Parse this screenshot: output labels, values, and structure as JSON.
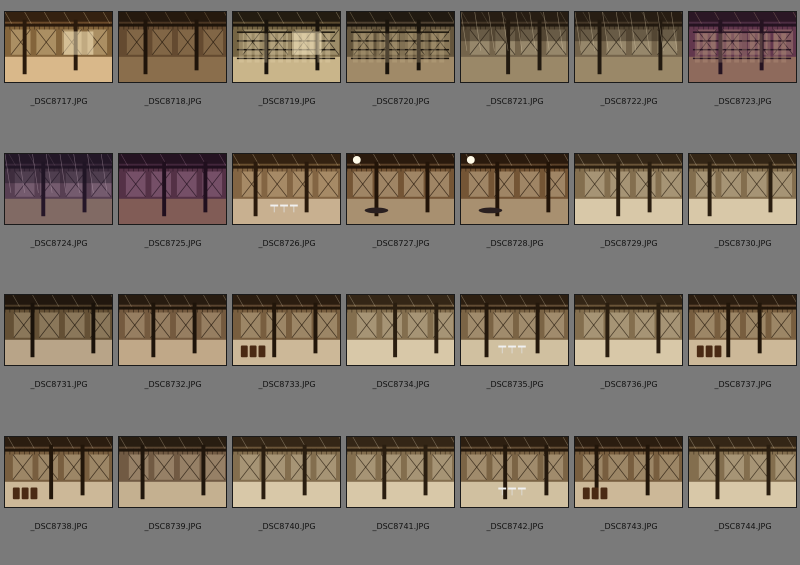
{
  "window": {
    "title": ""
  },
  "gallery": {
    "items": [
      {
        "filename": "_DSC8717.JPG",
        "scene": "corridor-lit"
      },
      {
        "filename": "_DSC8718.JPG",
        "scene": "corridor-dark"
      },
      {
        "filename": "_DSC8719.JPG",
        "scene": "shelves-lit"
      },
      {
        "filename": "_DSC8720.JPG",
        "scene": "shelves"
      },
      {
        "filename": "_DSC8721.JPG",
        "scene": "ceiling"
      },
      {
        "filename": "_DSC8722.JPG",
        "scene": "ceiling"
      },
      {
        "filename": "_DSC8723.JPG",
        "scene": "shelves-purple"
      },
      {
        "filename": "_DSC8724.JPG",
        "scene": "ceiling-purple"
      },
      {
        "filename": "_DSC8725.JPG",
        "scene": "room-purple"
      },
      {
        "filename": "_DSC8726.JPG",
        "scene": "room-tables"
      },
      {
        "filename": "_DSC8727.JPG",
        "scene": "room-lamp"
      },
      {
        "filename": "_DSC8728.JPG",
        "scene": "room-lamp"
      },
      {
        "filename": "_DSC8729.JPG",
        "scene": "hall-bright"
      },
      {
        "filename": "_DSC8730.JPG",
        "scene": "hall-bright"
      },
      {
        "filename": "_DSC8731.JPG",
        "scene": "hall-dark"
      },
      {
        "filename": "_DSC8732.JPG",
        "scene": "hall-pillars"
      },
      {
        "filename": "_DSC8733.JPG",
        "scene": "hall-barrels"
      },
      {
        "filename": "_DSC8734.JPG",
        "scene": "hall-bright"
      },
      {
        "filename": "_DSC8735.JPG",
        "scene": "hall-tables"
      },
      {
        "filename": "_DSC8736.JPG",
        "scene": "hall-bright"
      },
      {
        "filename": "_DSC8737.JPG",
        "scene": "hall-barrels"
      },
      {
        "filename": "_DSC8738.JPG",
        "scene": "hall-barrels"
      },
      {
        "filename": "_DSC8739.JPG",
        "scene": "hall-angle"
      },
      {
        "filename": "_DSC8740.JPG",
        "scene": "hall-bright"
      },
      {
        "filename": "_DSC8741.JPG",
        "scene": "hall-bright"
      },
      {
        "filename": "_DSC8742.JPG",
        "scene": "hall-tables"
      },
      {
        "filename": "_DSC8743.JPG",
        "scene": "hall-barrels"
      },
      {
        "filename": "_DSC8744.JPG",
        "scene": "hall-bright"
      }
    ]
  },
  "colors": {
    "background": "#7a7a7a",
    "caption": "#111111",
    "thumb_border": "#1a1a1a"
  }
}
